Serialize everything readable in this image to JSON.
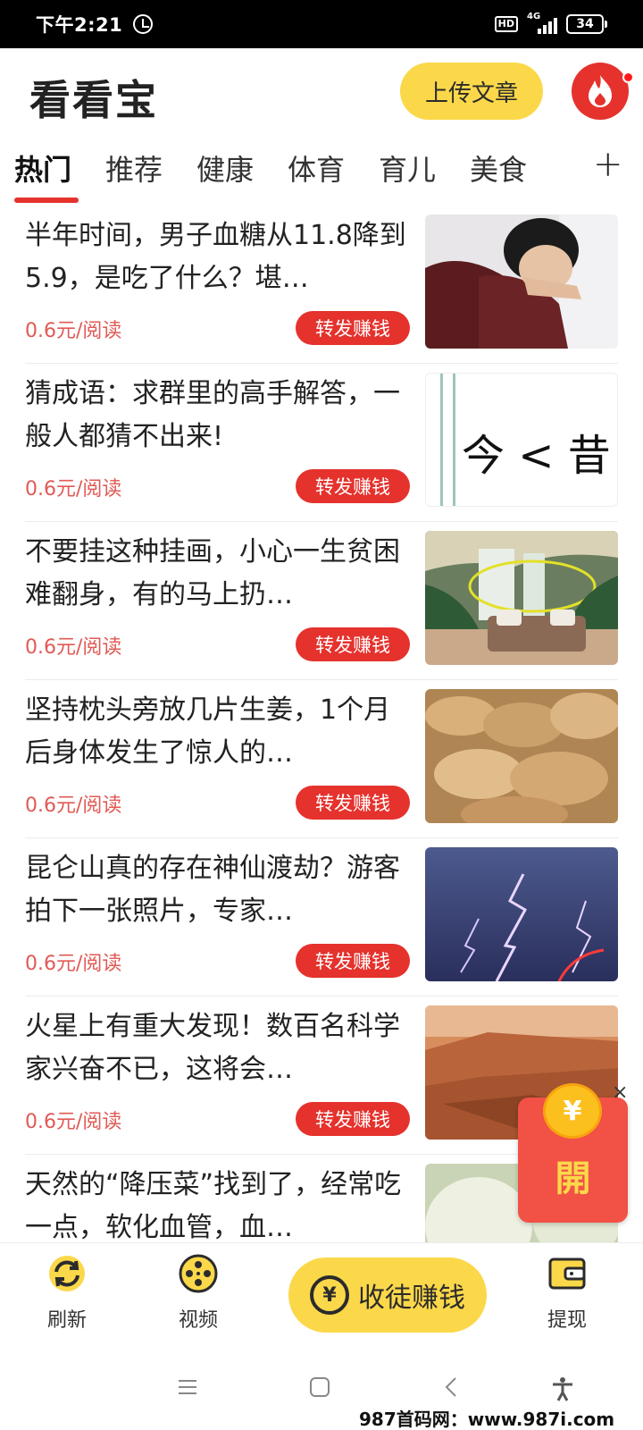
{
  "status_bar": {
    "time": "下午2:21",
    "hd": "HD",
    "network": "4G",
    "battery": "34"
  },
  "header": {
    "app_title": "看看宝",
    "upload_label": "上传文章"
  },
  "tabs": [
    {
      "label": "热门",
      "active": true
    },
    {
      "label": "推荐"
    },
    {
      "label": "健康"
    },
    {
      "label": "体育"
    },
    {
      "label": "育儿"
    },
    {
      "label": "美食"
    }
  ],
  "tab_add": "+",
  "articles": [
    {
      "title": "半年时间，男子血糖从11.8降到5.9，是吃了什么？堪…",
      "price": "0.6元/阅读",
      "share_label": "转发赚钱"
    },
    {
      "title": "猜成语：求群里的高手解答，一般人都猜不出来!",
      "price": "0.6元/阅读",
      "share_label": "转发赚钱",
      "thumb_text": "今 < 昔"
    },
    {
      "title": "不要挂这种挂画，小心一生贫困难翻身，有的马上扔…",
      "price": "0.6元/阅读",
      "share_label": "转发赚钱"
    },
    {
      "title": "坚持枕头旁放几片生姜，1个月后身体发生了惊人的…",
      "price": "0.6元/阅读",
      "share_label": "转发赚钱"
    },
    {
      "title": "昆仑山真的存在神仙渡劫？游客拍下一张照片，专家…",
      "price": "0.6元/阅读",
      "share_label": "转发赚钱"
    },
    {
      "title": "火星上有重大发现！数百名科学家兴奋不已，这将会…",
      "price": "0.6元/阅读",
      "share_label": "转发赚钱"
    },
    {
      "title": "天然的“降压菜”找到了，经常吃一点，软化血管，血…",
      "price": "",
      "share_label": ""
    }
  ],
  "red_packet": {
    "coin": "¥",
    "open_label": "開",
    "close": "×"
  },
  "bottom_nav": {
    "refresh": "刷新",
    "video": "视频",
    "recruit": "收徒赚钱",
    "recruit_coin": "¥",
    "withdraw": "提现"
  },
  "watermark": "987首码网：www.987i.com"
}
